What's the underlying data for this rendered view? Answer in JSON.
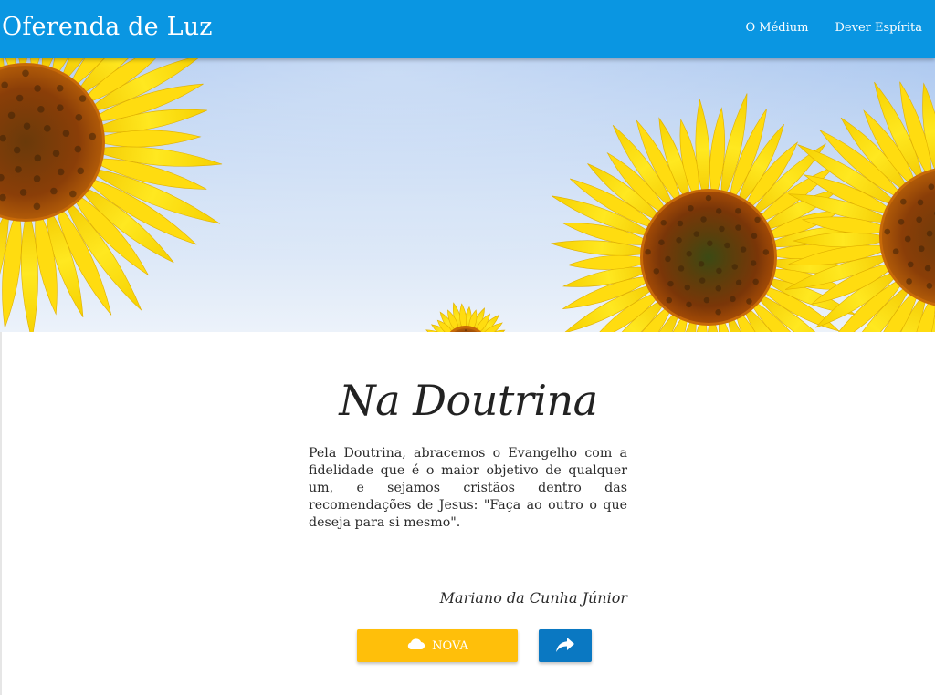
{
  "navbar": {
    "brand": "Oferenda de Luz",
    "links": [
      "O Médium",
      "Dever Espírita"
    ]
  },
  "hero": {
    "image": "sunflowers-sky-banner"
  },
  "message": {
    "title": "Na Doutrina",
    "text": "Pela Doutrina, abracemos o Evangelho com a fidelidade que é o maior objetivo de qualquer um, e sejamos cristãos dentro das recomendações de Jesus: \"Faça ao outro o que deseja para si mesmo\".",
    "author": "Mariano da Cunha Júnior"
  },
  "actions": {
    "new_label": "NOVA",
    "new_icon": "cloud-icon",
    "share_icon": "share-arrow-icon"
  },
  "colors": {
    "navbar": "#0a96e2",
    "new_button": "#ffbf0a",
    "share_button": "#0a78c2"
  }
}
